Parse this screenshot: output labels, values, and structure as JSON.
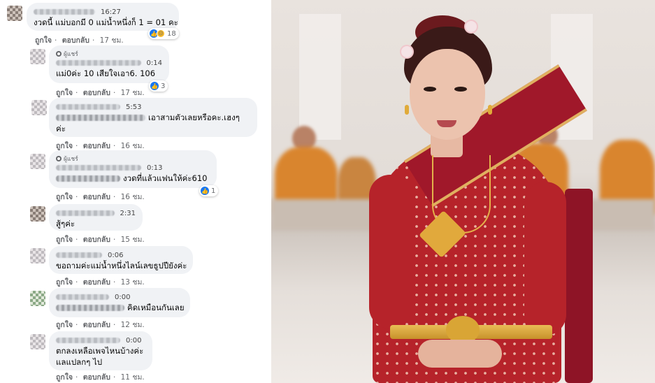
{
  "comments": [
    {
      "time": "16:27",
      "lines": [
        "งวดนี้ แม่บอกมี 0 แม่น้ำหนึ่งก็ 1 = 01 คะ"
      ],
      "like": "ถูกใจ",
      "reply": "ตอบกลับ",
      "ago": "17 ชม.",
      "reactions": "18"
    },
    {
      "fan": "ผู้แชร์",
      "time": "0:14",
      "lines": [
        "แม่0ค่ะ 10 เสียใจเอา6. 106"
      ],
      "like": "ถูกใจ",
      "reply": "ตอบกลับ",
      "ago": "17 ชม.",
      "reactions": "3"
    },
    {
      "time": "5:53",
      "lines": [
        "เอาสามตัวเลยหรือคะ.เฮงๆ",
        "ค่ะ"
      ],
      "like": "ถูกใจ",
      "reply": "ตอบกลับ",
      "ago": "16 ชม."
    },
    {
      "fan": "ผู้แชร์",
      "time": "0:13",
      "lines": [
        "งวดที่แล้วแฟนให้ค่ะ610"
      ],
      "like": "ถูกใจ",
      "reply": "ตอบกลับ",
      "ago": "16 ชม.",
      "reactions": "1"
    },
    {
      "time": "2:31",
      "lines": [
        "สู้ๆค่ะ"
      ],
      "like": "ถูกใจ",
      "reply": "ตอบกลับ",
      "ago": "15 ชม."
    },
    {
      "time": "0:06",
      "lines": [
        "ขอถามค่ะแม่น้ำหนึ่งไลน์เลขธูปปียังค่ะ"
      ],
      "like": "ถูกใจ",
      "reply": "ตอบกลับ",
      "ago": "13 ชม."
    },
    {
      "time": "0:00",
      "lines": [
        "คิดเหมือนกันเลย"
      ],
      "like": "ถูกใจ",
      "reply": "ตอบกลับ",
      "ago": "12 ชม."
    },
    {
      "time": "0:00",
      "lines": [
        "ตกลงเหลือเพจไหนบ้างค่ะ",
        "แลแปลกๆ ไป"
      ],
      "like": "ถูกใจ",
      "reply": "ตอบกลับ",
      "ago": "11 ชม."
    }
  ],
  "colors": {
    "bubble": "#f0f2f5",
    "meta": "#65676b",
    "like_blue": "#1877f2",
    "dress_red": "#b6232a"
  }
}
